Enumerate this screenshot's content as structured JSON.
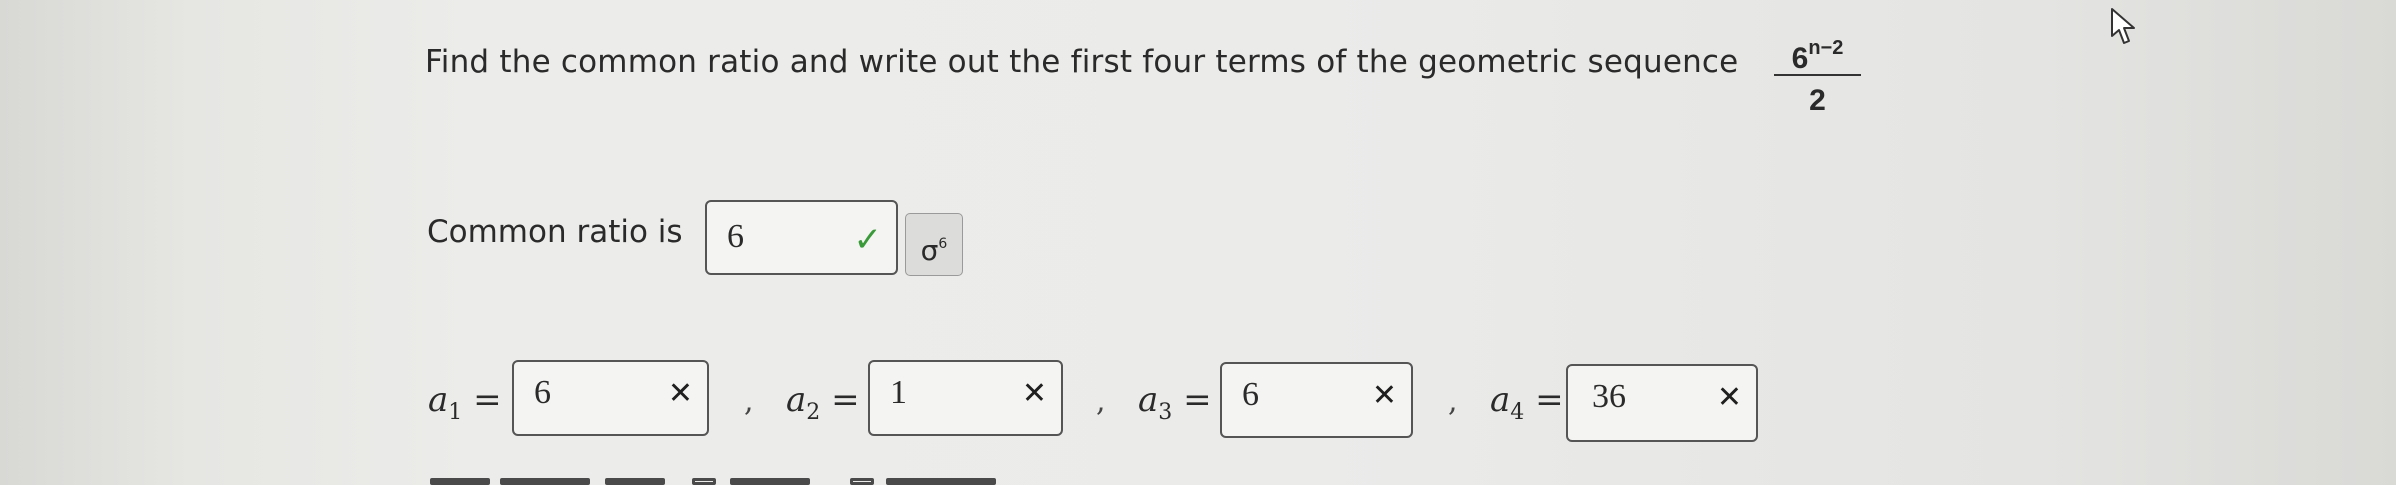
{
  "question": {
    "text": "Find the common ratio and write out the first four terms of the geometric sequence",
    "formula_base": "6",
    "formula_exponent": "n−2",
    "formula_denominator": "2"
  },
  "ratio": {
    "label": "Common ratio is",
    "value": "6",
    "status": "correct",
    "status_icon": "check-icon",
    "status_color": "#3a9a3a",
    "sigma_button_icon": "sigma-icon",
    "sigma_glyph": "σ",
    "sigma_sup": "6"
  },
  "terms": [
    {
      "name": "a",
      "index": "1",
      "equals": "=",
      "value": "6",
      "status": "incorrect",
      "separator": ","
    },
    {
      "name": "a",
      "index": "2",
      "equals": "=",
      "value": "1",
      "status": "incorrect",
      "separator": ","
    },
    {
      "name": "a",
      "index": "3",
      "equals": "=",
      "value": "6",
      "status": "incorrect",
      "separator": ","
    },
    {
      "name": "a",
      "index": "4",
      "equals": "=",
      "value": "36",
      "status": "incorrect",
      "separator": ""
    }
  ],
  "marks": {
    "check": "✓",
    "cross": "✕"
  }
}
